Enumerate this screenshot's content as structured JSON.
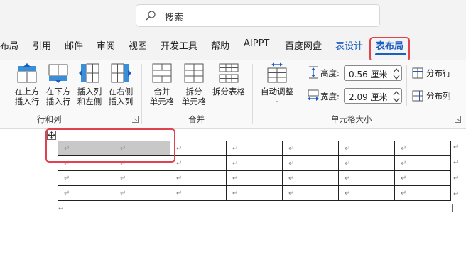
{
  "search": {
    "placeholder": "搜索"
  },
  "tabs": [
    "布局",
    "引用",
    "邮件",
    "审阅",
    "视图",
    "开发工具",
    "帮助",
    "AIPPT",
    "百度网盘",
    "表设计",
    "表布局"
  ],
  "ribbon": {
    "rows_cols": {
      "insert_above": [
        "在上方",
        "插入行"
      ],
      "insert_below": [
        "在下方",
        "插入行"
      ],
      "insert_left": [
        "插入列",
        "和左侧"
      ],
      "insert_right": [
        "在右侧",
        "插入列"
      ],
      "group_label": "行和列"
    },
    "merge": {
      "merge_cells": [
        "合并",
        "单元格"
      ],
      "split_cells": [
        "拆分",
        "单元格"
      ],
      "split_table": "拆分表格",
      "group_label": "合并"
    },
    "cell_size": {
      "autofit": "自动调整",
      "height_label": "高度:",
      "height_value": "0.56 厘米",
      "width_label": "宽度:",
      "width_value": "2.09 厘米",
      "distribute_rows": "分布行",
      "distribute_cols": "分布列",
      "group_label": "单元格大小"
    }
  },
  "document": {
    "cell_mark": "↵",
    "para_mark": "↵"
  },
  "colors": {
    "accent": "#1a5ec2",
    "highlight_box": "#e0424e",
    "selected_cell": "#c8c8c8"
  }
}
